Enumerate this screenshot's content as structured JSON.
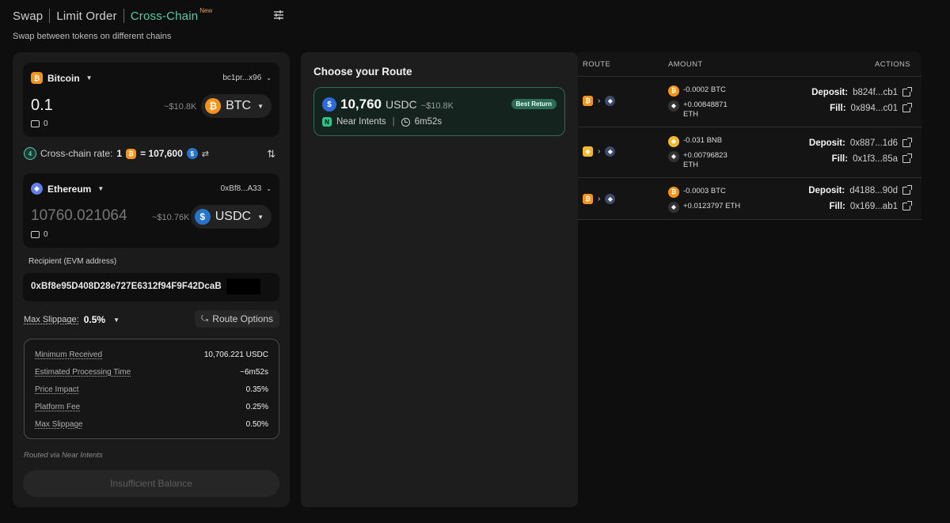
{
  "header": {
    "tabs": [
      {
        "label": "Swap"
      },
      {
        "label": "Limit Order"
      },
      {
        "label": "Cross-Chain",
        "badge": "New",
        "active": true
      }
    ],
    "subtitle": "Swap between tokens on different chains"
  },
  "from": {
    "chain": "Bitcoin",
    "address": "bc1pr...x96",
    "amount": "0.1",
    "usd_estimate": "~$10.8K",
    "token": "BTC",
    "balance": "0"
  },
  "rate": {
    "label": "Cross-chain rate:",
    "from_qty": "1",
    "equals": "= 107,600"
  },
  "to": {
    "chain": "Ethereum",
    "address": "0xBf8...A33",
    "amount": "10760.021064",
    "usd_estimate": "~$10.76K",
    "token": "USDC",
    "balance": "0"
  },
  "recipient": {
    "label": "Recipient (EVM address)",
    "value": "0xBf8e95D408D28e727E6312f94F9F42DcaB"
  },
  "slippage": {
    "label": "Max Slippage:",
    "value": "0.5%"
  },
  "route_options_label": "Route Options",
  "details": [
    {
      "label": "Minimum Received",
      "value": "10,706.221 USDC"
    },
    {
      "label": "Estimated Processing Time",
      "value": "~6m52s"
    },
    {
      "label": "Price Impact",
      "value": "0.35%"
    },
    {
      "label": "Platform Fee",
      "value": "0.25%"
    },
    {
      "label": "Max Slippage",
      "value": "0.50%"
    }
  ],
  "routed_via": "Routed via Near Intents",
  "submit_label": "Insufficient Balance",
  "route_panel": {
    "title": "Choose your Route",
    "route": {
      "amount": "10,760",
      "unit": "USDC",
      "usd": "~$10.8K",
      "badge": "Best Return",
      "provider": "Near Intents",
      "divider": "|",
      "time": "6m52s"
    }
  },
  "table": {
    "headers": {
      "route": "ROUTE",
      "amount": "AMOUNT",
      "actions": "ACTIONS"
    },
    "rows": [
      {
        "from_amt": "-0.0002 BTC",
        "to_amt": "+0.00848871 ETH",
        "deposit_label": "Deposit:",
        "deposit": "b824f...cb1",
        "fill_label": "Fill:",
        "fill": "0x894...c01"
      },
      {
        "from_amt": "-0.031 BNB",
        "to_amt": "+0.00796823 ETH",
        "deposit_label": "Deposit:",
        "deposit": "0x887...1d6",
        "fill_label": "Fill:",
        "fill": "0x1f3...85a"
      },
      {
        "from_amt": "-0.0003 BTC",
        "to_amt": "+0.0123797 ETH",
        "deposit_label": "Deposit:",
        "deposit": "d4188...90d",
        "fill_label": "Fill:",
        "fill": "0x169...ab1"
      }
    ]
  },
  "colors": {
    "accent": "#4fd1a5",
    "btc": "#f7931a",
    "eth": "#627eea",
    "usdc": "#2775ca",
    "bnb": "#f3ba2f",
    "new_badge": "#f2994a"
  },
  "icons": {
    "settings": "sliders-icon",
    "bitcoin": "bitcoin-icon",
    "ethereum": "ethereum-icon",
    "usdc": "usdc-icon",
    "wallet": "wallet-icon",
    "swap": "swap-direction-icon",
    "external": "external-link-icon"
  }
}
